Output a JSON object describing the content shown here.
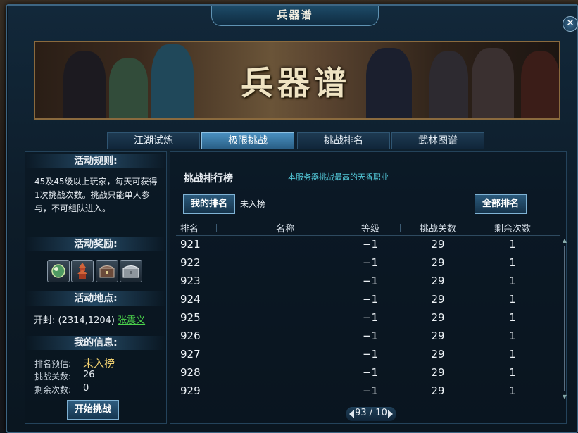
{
  "window": {
    "title": "兵器谱",
    "close_icon": "close-icon"
  },
  "banner": {
    "title": "兵器谱"
  },
  "tabs": [
    {
      "label": "江湖试炼",
      "active": false
    },
    {
      "label": "极限挑战",
      "active": true
    },
    {
      "label": "挑战排名",
      "active": false
    },
    {
      "label": "武林图谱",
      "active": false
    }
  ],
  "left": {
    "rules_title": "活动规则:",
    "rules_text": "45及45级以上玩家，每天可获得1次挑战次数。挑战只能单人参与，不可组队进入。",
    "rewards_title": "活动奖励:",
    "reward_icons": [
      "orb-icon",
      "pagoda-icon",
      "chest-icon",
      "silver-chest-icon"
    ],
    "location_title": "活动地点:",
    "location_prefix": "开封: (2314,1204)",
    "location_npc": "张震义",
    "myinfo_title": "我的信息:",
    "rank_label": "排名预估:",
    "rank_value": "未入榜",
    "stage_label": "挑战关数:",
    "stage_value": "26",
    "remain_label": "剩余次数:",
    "remain_value": "0",
    "start_button": "开始挑战"
  },
  "right": {
    "title": "挑战排行榜",
    "note": "本服务器挑战最高的天香职业",
    "my_rank_button": "我的排名",
    "my_rank_value": "未入榜",
    "all_rank_button": "全部排名",
    "columns": [
      "排名",
      "名称",
      "等级",
      "挑战关数",
      "剩余次数"
    ],
    "rows": [
      {
        "rank": "921",
        "name": "",
        "level": "−1",
        "stage": "29",
        "remain": "1"
      },
      {
        "rank": "922",
        "name": "",
        "level": "−1",
        "stage": "29",
        "remain": "1"
      },
      {
        "rank": "923",
        "name": "",
        "level": "−1",
        "stage": "29",
        "remain": "1"
      },
      {
        "rank": "924",
        "name": "",
        "level": "−1",
        "stage": "29",
        "remain": "1"
      },
      {
        "rank": "925",
        "name": "",
        "level": "−1",
        "stage": "29",
        "remain": "1"
      },
      {
        "rank": "926",
        "name": "",
        "level": "−1",
        "stage": "29",
        "remain": "1"
      },
      {
        "rank": "927",
        "name": "",
        "level": "−1",
        "stage": "29",
        "remain": "1"
      },
      {
        "rank": "928",
        "name": "",
        "level": "−1",
        "stage": "29",
        "remain": "1"
      },
      {
        "rank": "929",
        "name": "",
        "level": "−1",
        "stage": "29",
        "remain": "1"
      }
    ],
    "pager": "93 / 10"
  }
}
